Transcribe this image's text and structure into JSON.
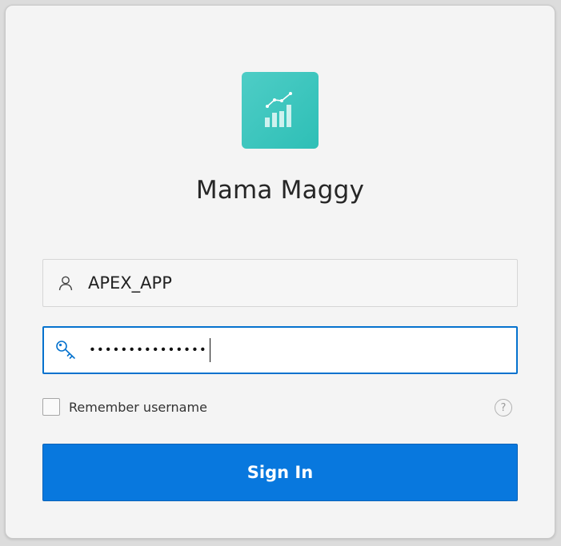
{
  "app": {
    "title": "Mama Maggy",
    "logo_icon": "chart-icon",
    "logo_color": "#3cc6be"
  },
  "login": {
    "username_icon": "user-icon",
    "username_value": "APEX_APP",
    "password_icon": "key-icon",
    "password_value": "•••••••••••••••",
    "remember_label": "Remember username",
    "remember_checked": false,
    "help_icon": "help-icon",
    "help_glyph": "?",
    "signin_label": "Sign In",
    "accent_color": "#0878de"
  }
}
